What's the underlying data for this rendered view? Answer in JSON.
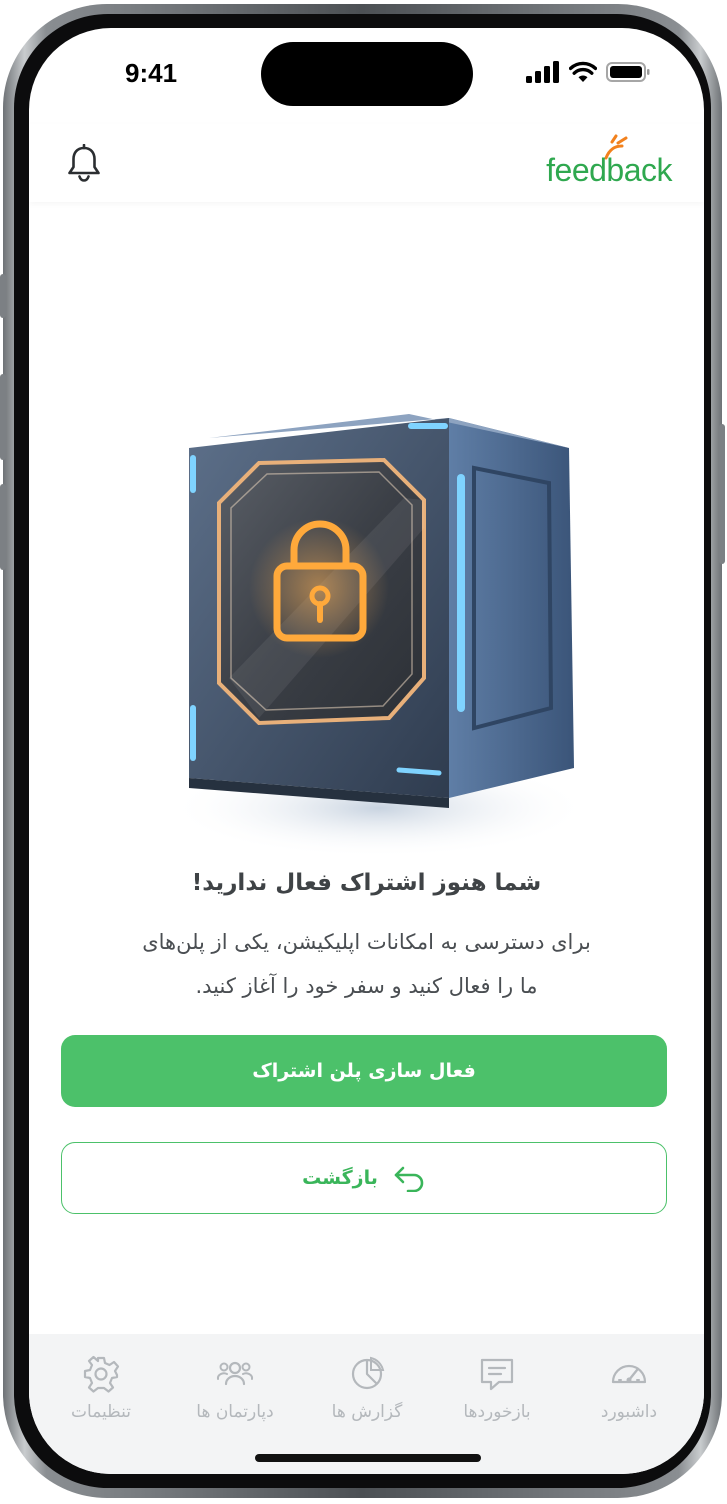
{
  "status_bar": {
    "time": "9:41"
  },
  "header": {
    "logo_text": "feedback",
    "notification_icon": "bell-icon",
    "brand_color": "#2fa84f"
  },
  "main": {
    "illustration": "locked-cube-padlock",
    "title": "شما هنوز اشتراک فعال ندارید!",
    "description_line1": "برای دسترسی به امکانات اپلیکیشن، یکی از پلن‌های",
    "description_line2": "ما را فعال کنید و سفر خود را آغاز کنید.",
    "activate_button": "فعال سازی پلن اشتراک",
    "back_button": "بازگشت",
    "accent_color": "#4cc16a"
  },
  "tabbar": {
    "items": [
      {
        "label": "تنظیمات",
        "icon": "gear-icon"
      },
      {
        "label": "دپارتمان ها",
        "icon": "users-icon"
      },
      {
        "label": "گزارش ها",
        "icon": "pie-chart-icon"
      },
      {
        "label": "بازخوردها",
        "icon": "message-icon"
      },
      {
        "label": "داشبورد",
        "icon": "gauge-icon"
      }
    ],
    "inactive_color": "#b4b8bc"
  }
}
